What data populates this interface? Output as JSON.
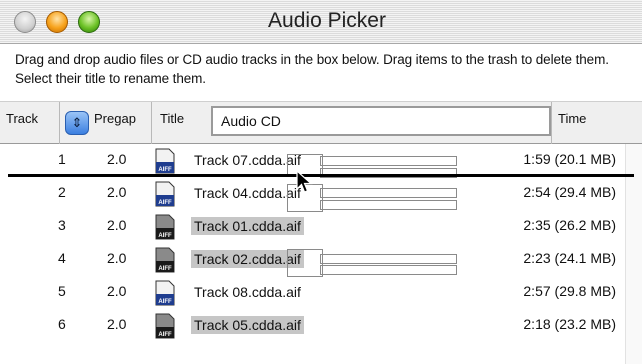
{
  "window": {
    "title": "Audio Picker",
    "instruction": "Drag and drop audio files or CD audio tracks in the box below. Drag items to the trash to delete them. Select their title to rename them."
  },
  "header": {
    "track": "Track",
    "pregap": "Pregap",
    "title": "Title",
    "title_value": "Audio CD",
    "time": "Time",
    "sort_icon": "up-down-arrows-icon"
  },
  "rows": [
    {
      "track": "1",
      "pregap": "2.0",
      "title": "Track 07.cdda.aif",
      "time": "1:59 (20.1 MB)",
      "selected": false,
      "icon": "aiff-file-icon"
    },
    {
      "track": "2",
      "pregap": "2.0",
      "title": "Track 04.cdda.aif",
      "time": "2:54 (29.4 MB)",
      "selected": false,
      "icon": "aiff-file-icon"
    },
    {
      "track": "3",
      "pregap": "2.0",
      "title": "Track 01.cdda.aif",
      "time": "2:35 (26.2 MB)",
      "selected": true,
      "icon": "aiff-file-icon"
    },
    {
      "track": "4",
      "pregap": "2.0",
      "title": "Track 02.cdda.aif",
      "time": "2:23 (24.1 MB)",
      "selected": true,
      "icon": "aiff-file-icon"
    },
    {
      "track": "5",
      "pregap": "2.0",
      "title": "Track 08.cdda.aif",
      "time": "2:57 (29.8 MB)",
      "selected": false,
      "icon": "aiff-file-icon"
    },
    {
      "track": "6",
      "pregap": "2.0",
      "title": "Track 05.cdda.aif",
      "time": "2:18 (23.2 MB)",
      "selected": true,
      "icon": "aiff-file-icon"
    }
  ],
  "icon_text": "AIFF"
}
